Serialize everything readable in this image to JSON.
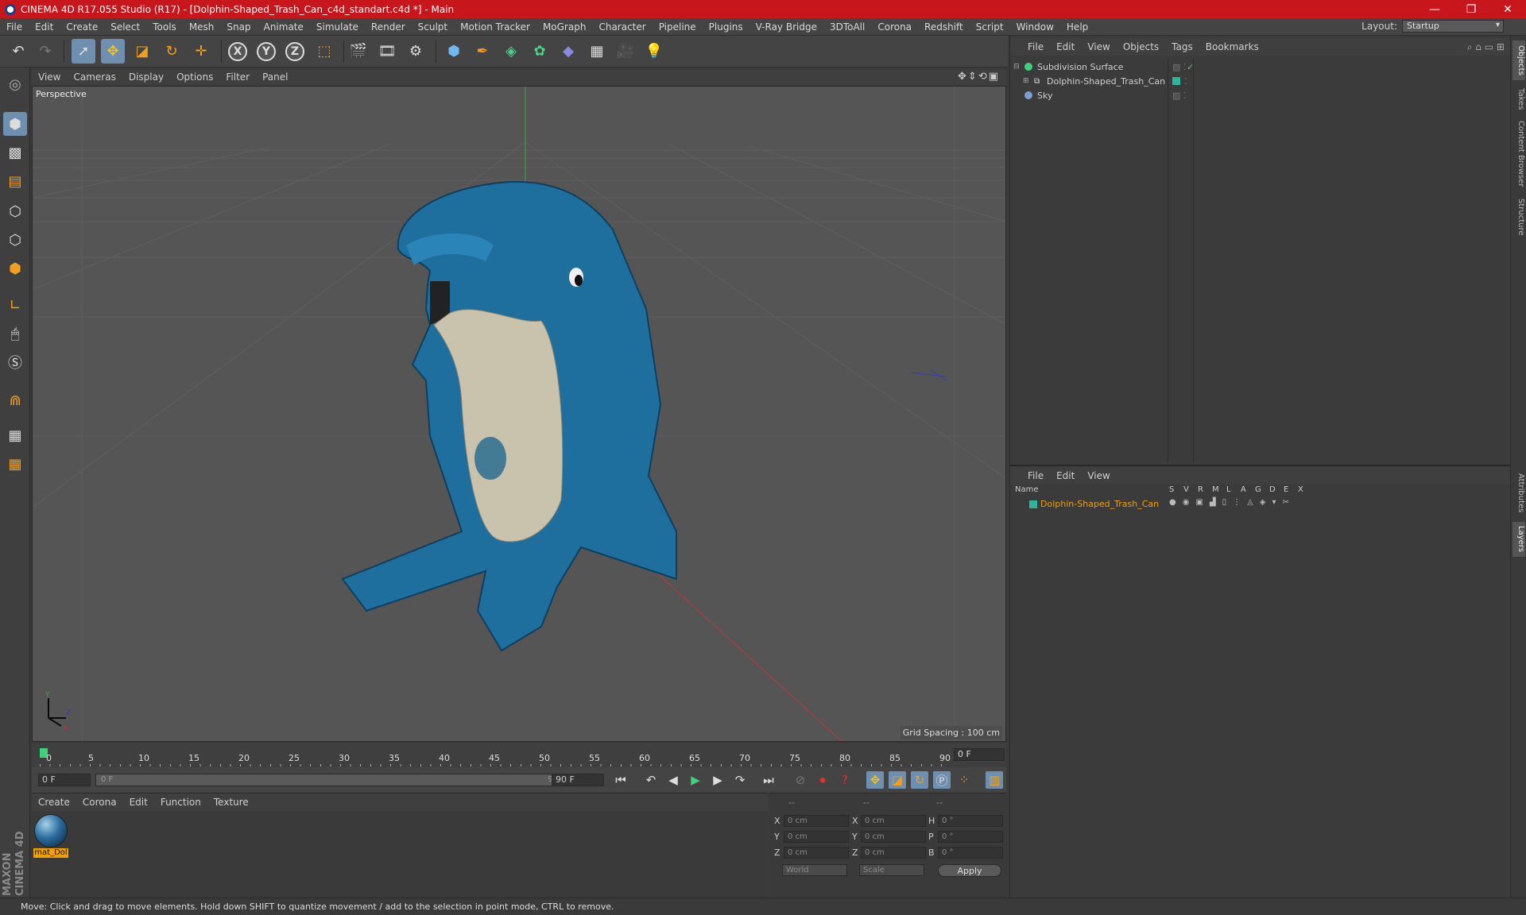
{
  "app": {
    "title": "CINEMA 4D R17.055 Studio (R17) - [Dolphin-Shaped_Trash_Can_c4d_standart.c4d *] - Main",
    "window_buttons": [
      "—",
      "❐",
      "✕"
    ]
  },
  "menu": [
    "File",
    "Edit",
    "Create",
    "Select",
    "Tools",
    "Mesh",
    "Snap",
    "Animate",
    "Simulate",
    "Render",
    "Sculpt",
    "Motion Tracker",
    "MoGraph",
    "Character",
    "Pipeline",
    "Plugins",
    "V-Ray Bridge",
    "3DToAll",
    "Corona",
    "Redshift",
    "Script",
    "Window",
    "Help"
  ],
  "layout": {
    "label": "Layout:",
    "value": "Startup"
  },
  "toolbar": {
    "icons": [
      "undo-icon",
      "redo-icon",
      "select-arrow-icon",
      "move-icon",
      "scale-icon",
      "rotate-icon",
      "live-move-icon",
      "x-axis-icon",
      "y-axis-icon",
      "z-axis-icon",
      "coordinate-system-icon",
      "render-view-icon",
      "render-picture-icon",
      "render-settings-icon",
      "cube-icon",
      "pen-icon",
      "subdivision-icon",
      "cloner-icon",
      "deformer-icon",
      "floor-icon",
      "camera-icon",
      "light-icon"
    ],
    "axes": [
      "X",
      "Y",
      "Z"
    ]
  },
  "viewport": {
    "menu": [
      "View",
      "Cameras",
      "Display",
      "Options",
      "Filter",
      "Panel"
    ],
    "label": "Perspective",
    "grid_spacing": "Grid Spacing : 100 cm"
  },
  "timeline": {
    "ticks": [
      "0",
      "5",
      "10",
      "15",
      "20",
      "25",
      "30",
      "35",
      "40",
      "45",
      "50",
      "55",
      "60",
      "65",
      "70",
      "75",
      "80",
      "85",
      "90"
    ],
    "frame": "0 F",
    "start_field": "0 F",
    "slider_start": "0 F",
    "slider_end": "90 F",
    "end_field": "90 F"
  },
  "materials": {
    "menu": [
      "Create",
      "Corona",
      "Edit",
      "Function",
      "Texture"
    ],
    "items": [
      {
        "name": "mat_Dol"
      }
    ]
  },
  "coords": {
    "headers": [
      "--",
      "--",
      "--"
    ],
    "rows": [
      {
        "a": "X",
        "av": "0 cm",
        "b": "X",
        "bv": "0 cm",
        "c": "H",
        "cv": "0 °"
      },
      {
        "a": "Y",
        "av": "0 cm",
        "b": "Y",
        "bv": "0 cm",
        "c": "P",
        "cv": "0 °"
      },
      {
        "a": "Z",
        "av": "0 cm",
        "b": "Z",
        "bv": "0 cm",
        "c": "B",
        "cv": "0 °"
      }
    ],
    "world": "World",
    "scale": "Scale",
    "apply": "Apply"
  },
  "objects": {
    "menu": [
      "File",
      "Edit",
      "View",
      "Objects",
      "Tags",
      "Bookmarks"
    ],
    "items": [
      {
        "name": "Subdivision Surface",
        "color": "#3fd07a"
      },
      {
        "name": "Dolphin-Shaped_Trash_Can",
        "color": "#2fb39a"
      },
      {
        "name": "Sky",
        "color": "#7a9fd0"
      }
    ]
  },
  "layers": {
    "menu": [
      "File",
      "Edit",
      "View"
    ],
    "header_name": "Name",
    "columns": [
      "S",
      "V",
      "R",
      "M",
      "L",
      "A",
      "G",
      "D",
      "E",
      "X"
    ],
    "items": [
      {
        "name": "Dolphin-Shaped_Trash_Can",
        "color": "#f0a000"
      }
    ]
  },
  "side_tabs": [
    "Objects",
    "Takes",
    "Content Browser",
    "Structure",
    "Attributes",
    "Layers"
  ],
  "status": "Move: Click and drag to move elements. Hold down SHIFT to quantize movement / add to the selection in point mode, CTRL to remove.",
  "brand": "MAXON CINEMA 4D"
}
